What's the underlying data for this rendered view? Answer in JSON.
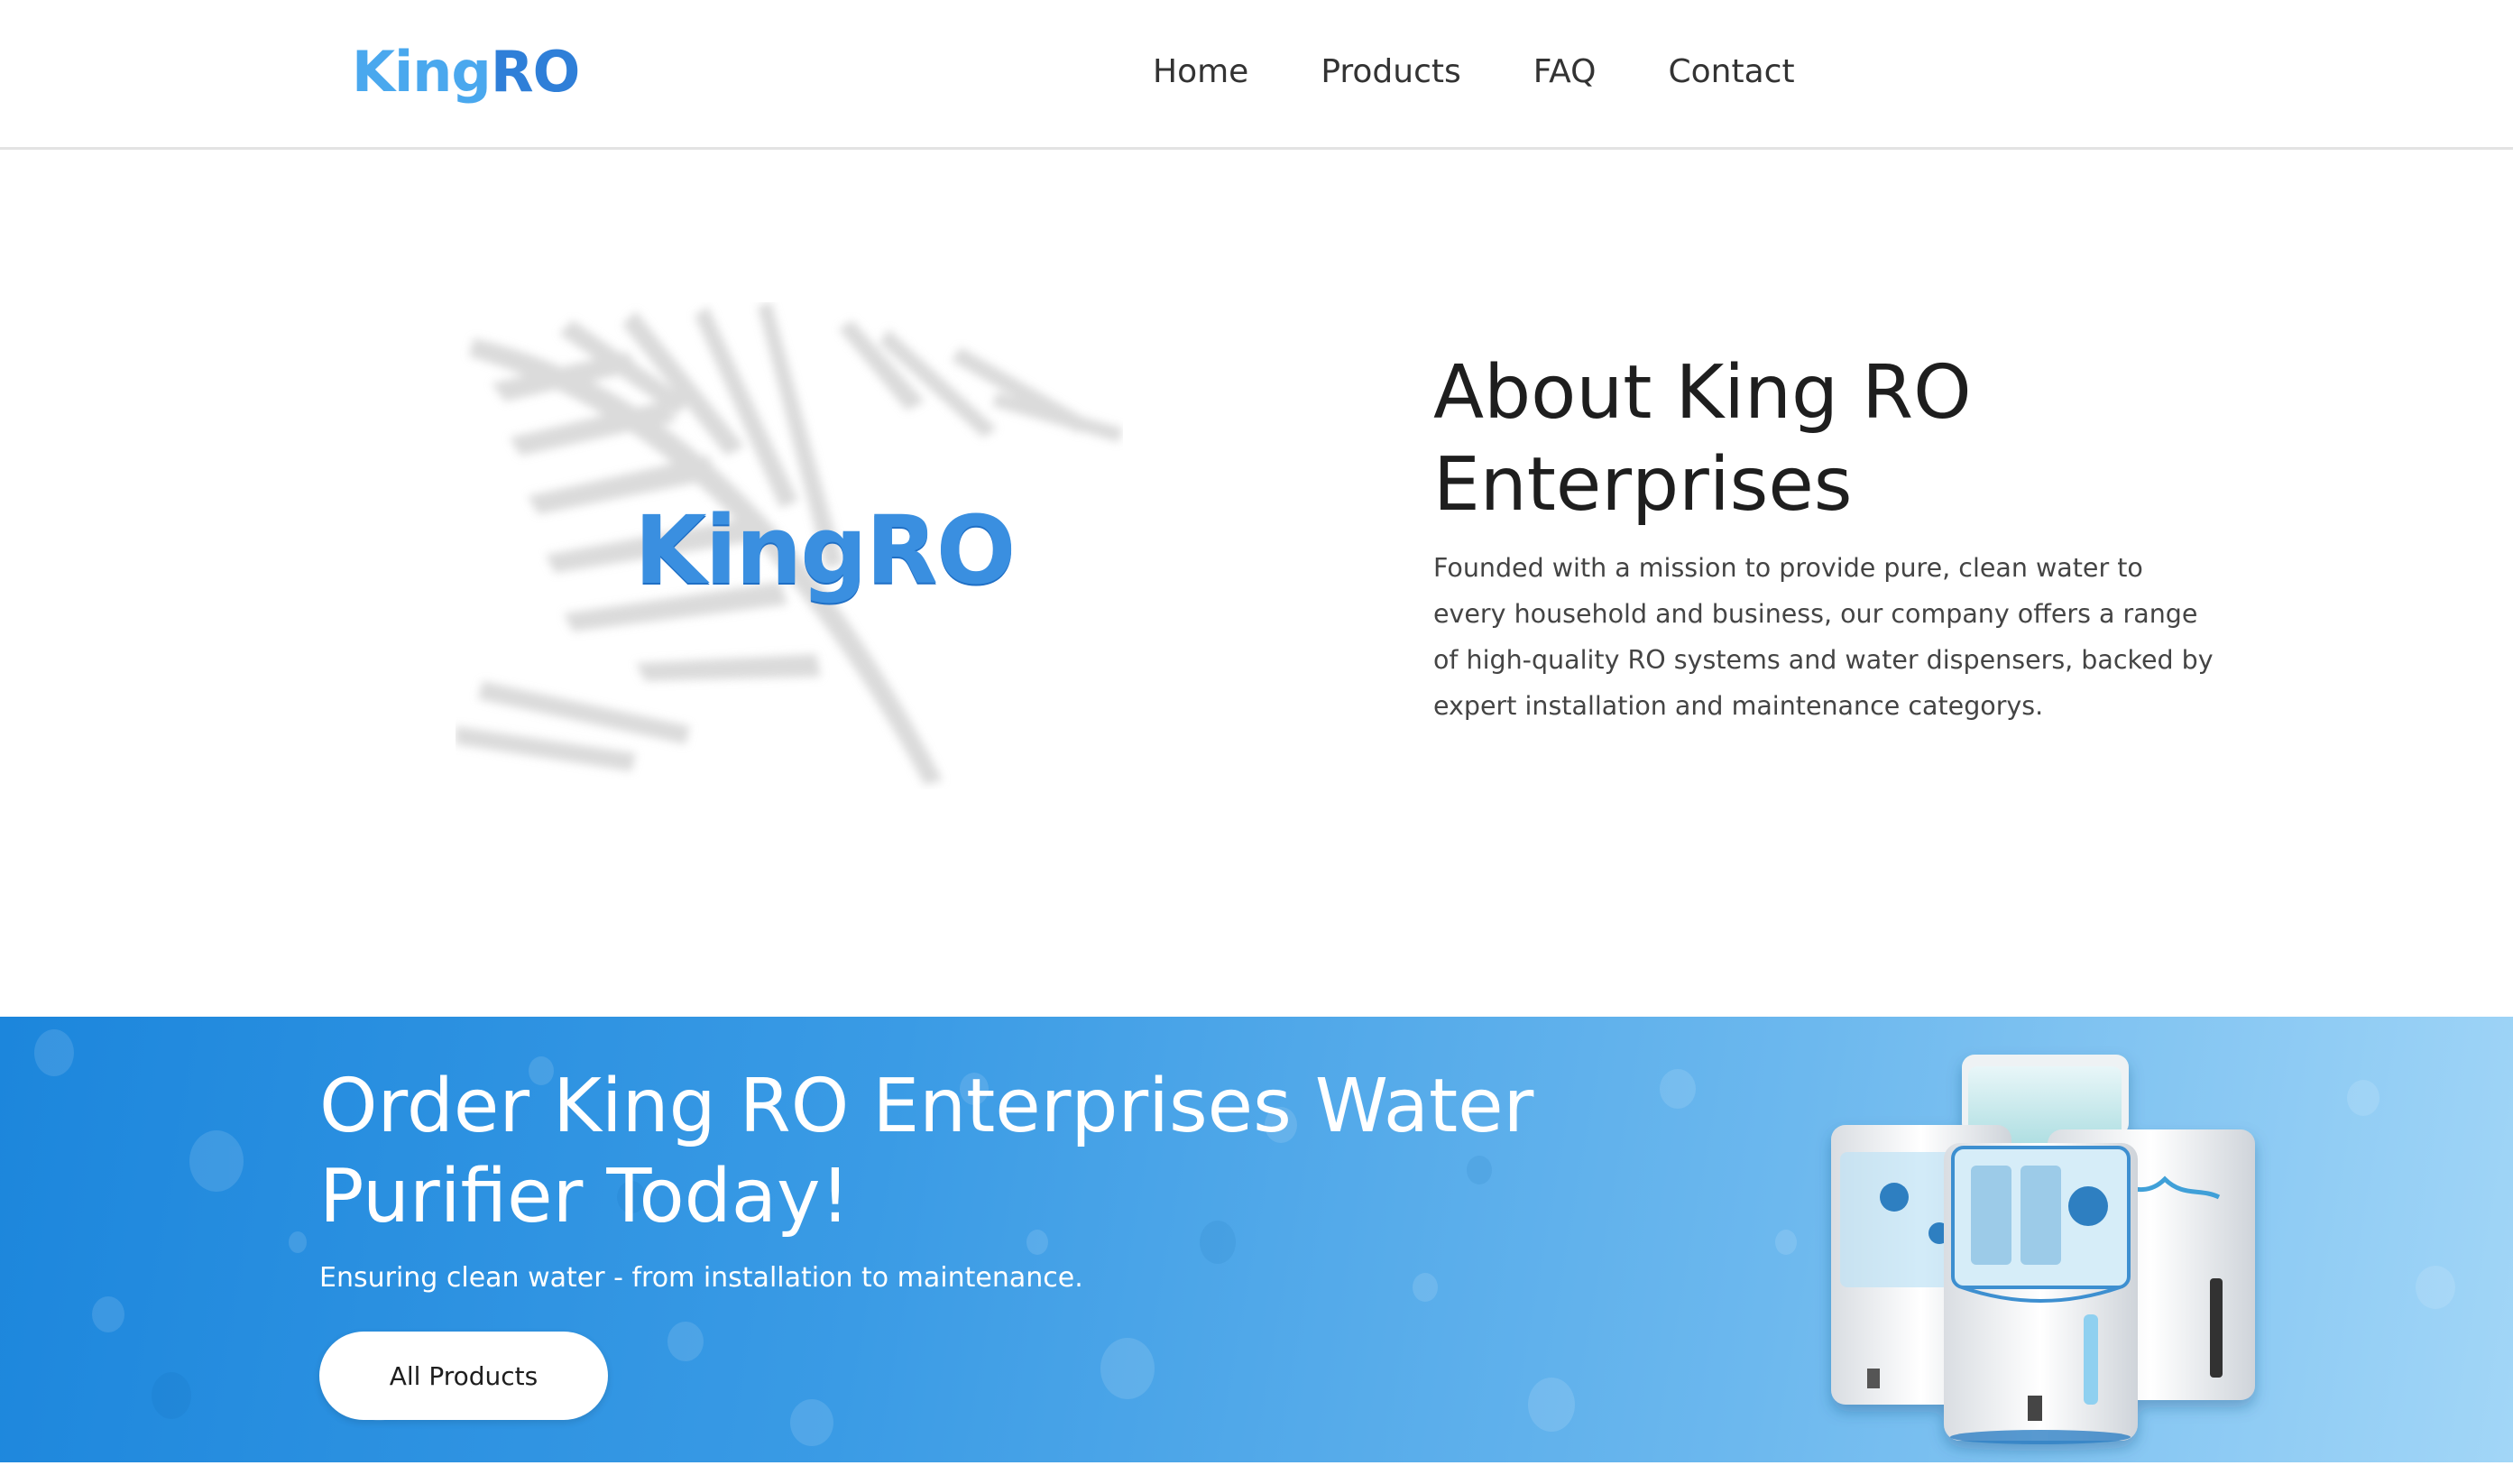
{
  "header": {
    "logo_text_a": "King",
    "logo_text_b": "RO",
    "nav": [
      "Home",
      "Products",
      "FAQ",
      "Contact"
    ]
  },
  "about": {
    "logo_text_a": "King",
    "logo_text_b": "RO",
    "title": "About King RO Enterprises",
    "text": "Founded with a mission to provide pure, clean water to every household and business, our company offers a range of high-quality RO systems and water dispensers, backed by expert installation and maintenance categorys."
  },
  "banner": {
    "title": "Order King RO Enterprises Water Purifier Today!",
    "subtitle": "Ensuring clean water - from installation to maintenance.",
    "button_label": "All Products"
  },
  "colors": {
    "brand_blue": "#3a8fe0",
    "banner_start": "#1c86dc",
    "banner_end": "#a2d6f7"
  },
  "icons": [
    "palm-leaf-shadow",
    "water-purifier-image"
  ]
}
